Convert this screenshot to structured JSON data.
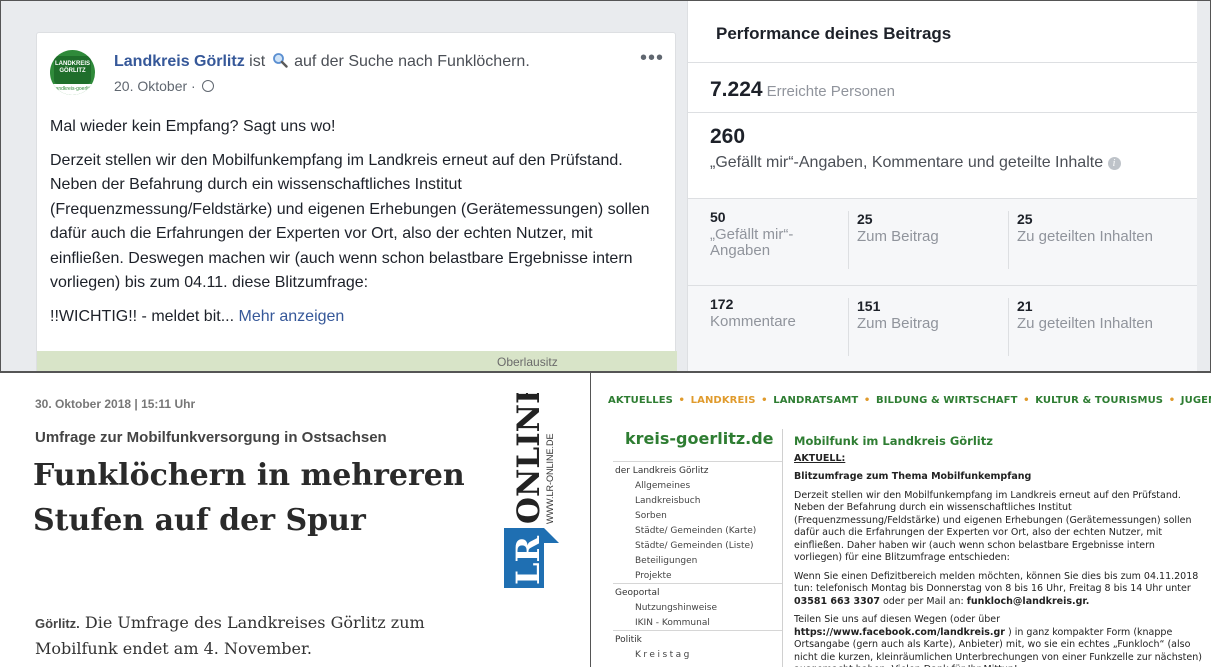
{
  "facebook_post": {
    "page_name": "Landkreis Görlitz",
    "status_prefix": "ist",
    "status_suffix": "auf der Suche nach Funklöchern.",
    "date": "20. Oktober ·",
    "avatar_lines": [
      "LANDKREIS",
      "GÖRLITZ"
    ],
    "avatar_footer": "Landkreis-goerlitz",
    "more_menu": "•••",
    "text_p1": "Mal wieder kein Empfang? Sagt uns wo!",
    "text_p2": "Derzeit stellen wir den Mobilfunkempfang im Landkreis erneut auf den Prüfstand. Neben der Befahrung durch ein wissenschaftliches Institut (Frequenzmessung/Feldstärke) und eigenen Erhebungen (Gerätemessungen) sollen dafür auch die Erfahrungen der Experten vor Ort, also der echten Nutzer, mit einfließen. Deswegen machen wir (auch wenn schon belastbare Ergebnisse intern vorliegen) bis zum 04.11. diese Blitzumfrage:",
    "text_p3": "!!WICHTIG!! - meldet bit...",
    "show_more": "Mehr anzeigen",
    "map_label": "Oberlausitz"
  },
  "performance": {
    "title": "Performance deines Beitrags",
    "reach_value": "7.224",
    "reach_label": "Erreichte Personen",
    "engagement_value": "260",
    "engagement_label": "„Gefällt mir“-Angaben, Kommentare und geteilte Inhalte",
    "info_glyph": "i",
    "likes": [
      {
        "value": "50",
        "label": "„Gefällt mir“-Angaben"
      },
      {
        "value": "25",
        "label": "Zum Beitrag"
      },
      {
        "value": "25",
        "label": "Zu geteilten Inhalten"
      }
    ],
    "comments": [
      {
        "value": "172",
        "label": "Kommentare"
      },
      {
        "value": "151",
        "label": "Zum Beitrag"
      },
      {
        "value": "21",
        "label": "Zu geteilten Inhalten"
      }
    ]
  },
  "lr_article": {
    "date": "30. Oktober 2018 | 15:11 Uhr",
    "kicker": "Umfrage zur Mobilfunkversorgung in Ostsachsen",
    "headline": "Funklöchern in mehreren Stufen auf der Spur",
    "dateline": "Görlitz.",
    "body": "Die Umfrage des Landkreises Görlitz zum Mobilfunk endet am 4. November.",
    "logo_main": "ONLINE",
    "logo_letters": "LR",
    "logo_url": "WWW.LR-ONLINE.DE",
    "accent_color": "#1f6fb2"
  },
  "kg_site": {
    "nav": [
      {
        "label": "AKTUELLES",
        "active": false
      },
      {
        "label": "LANDKREIS",
        "active": true
      },
      {
        "label": "LANDRATSAMT",
        "active": false
      },
      {
        "label": "BILDUNG & WIRTSCHAFT",
        "active": false
      },
      {
        "label": "KULTUR & TOURISMUS",
        "active": false
      },
      {
        "label": "JUGEND & GESUNI",
        "active": false
      }
    ],
    "nav_sep": "•",
    "logo": "kreis-goerlitz.de",
    "menu": [
      {
        "label": "der Landkreis Görlitz",
        "kind": "grp"
      },
      {
        "label": "Allgemeines",
        "kind": "itm"
      },
      {
        "label": "Landkreisbuch",
        "kind": "itm"
      },
      {
        "label": "Sorben",
        "kind": "itm"
      },
      {
        "label": "Städte/ Gemeinden (Karte)",
        "kind": "itm"
      },
      {
        "label": "Städte/ Gemeinden (Liste)",
        "kind": "itm"
      },
      {
        "label": "Beteiligungen",
        "kind": "itm"
      },
      {
        "label": "Projekte",
        "kind": "itm"
      },
      {
        "label": "Geoportal",
        "kind": "grp"
      },
      {
        "label": "Nutzungshinweise",
        "kind": "itm"
      },
      {
        "label": "IKIN - Kommunal",
        "kind": "itm"
      },
      {
        "label": "Politik",
        "kind": "grp"
      },
      {
        "label": "Kreistag",
        "kind": "itm spaced"
      }
    ],
    "heading": "Mobilfunk im Landkreis Görlitz",
    "aktuell": "AKTUELL:",
    "subhead": "Blitzumfrage zum Thema Mobilfunkempfang",
    "p1": "Derzeit stellen wir den Mobilfunkempfang im Landkreis erneut auf den Prüfstand. Neben der Befahrung durch ein wissenschaftliches Institut (Frequenzmessung/Feldstärke) und eigenen Erhebungen (Gerätemessungen) sollen dafür auch die Erfahrungen der Experten vor Ort, also der echten Nutzer, mit einfließen.  Daher haben wir (auch wenn schon belastbare Ergebnisse intern vorliegen) für eine Blitzumfrage entschieden:",
    "p2_a": "Wenn Sie einen Defizitbereich melden möchten, können Sie dies bis zum 04.11.2018 tun: telefonisch Montag bis Donnerstag von 8 bis 16 Uhr, Freitag 8 bis 14 Uhr unter",
    "p2_phone": "03581 663 3307",
    "p2_b": "oder per Mail an:",
    "p2_mail": "funkloch@landkreis.gr.",
    "p3_a": "Teilen Sie uns auf diesen Wegen (oder über",
    "p3_link": "https://www.facebook.com/landkreis.gr",
    "p3_b": ") in ganz kompakter Form (knappe Ortsangabe (gern auch als Karte), Anbieter)  mit, wo sie ein echtes „Funkloch“ (also nicht die kurzen, kleinräumlichen Unterbrechungen von einer Funkzelle zur nächsten) ausgemacht haben.  Vielen Dank für Ihr Mittun!",
    "green": "#2e7d32",
    "orange": "#e09b2d"
  }
}
